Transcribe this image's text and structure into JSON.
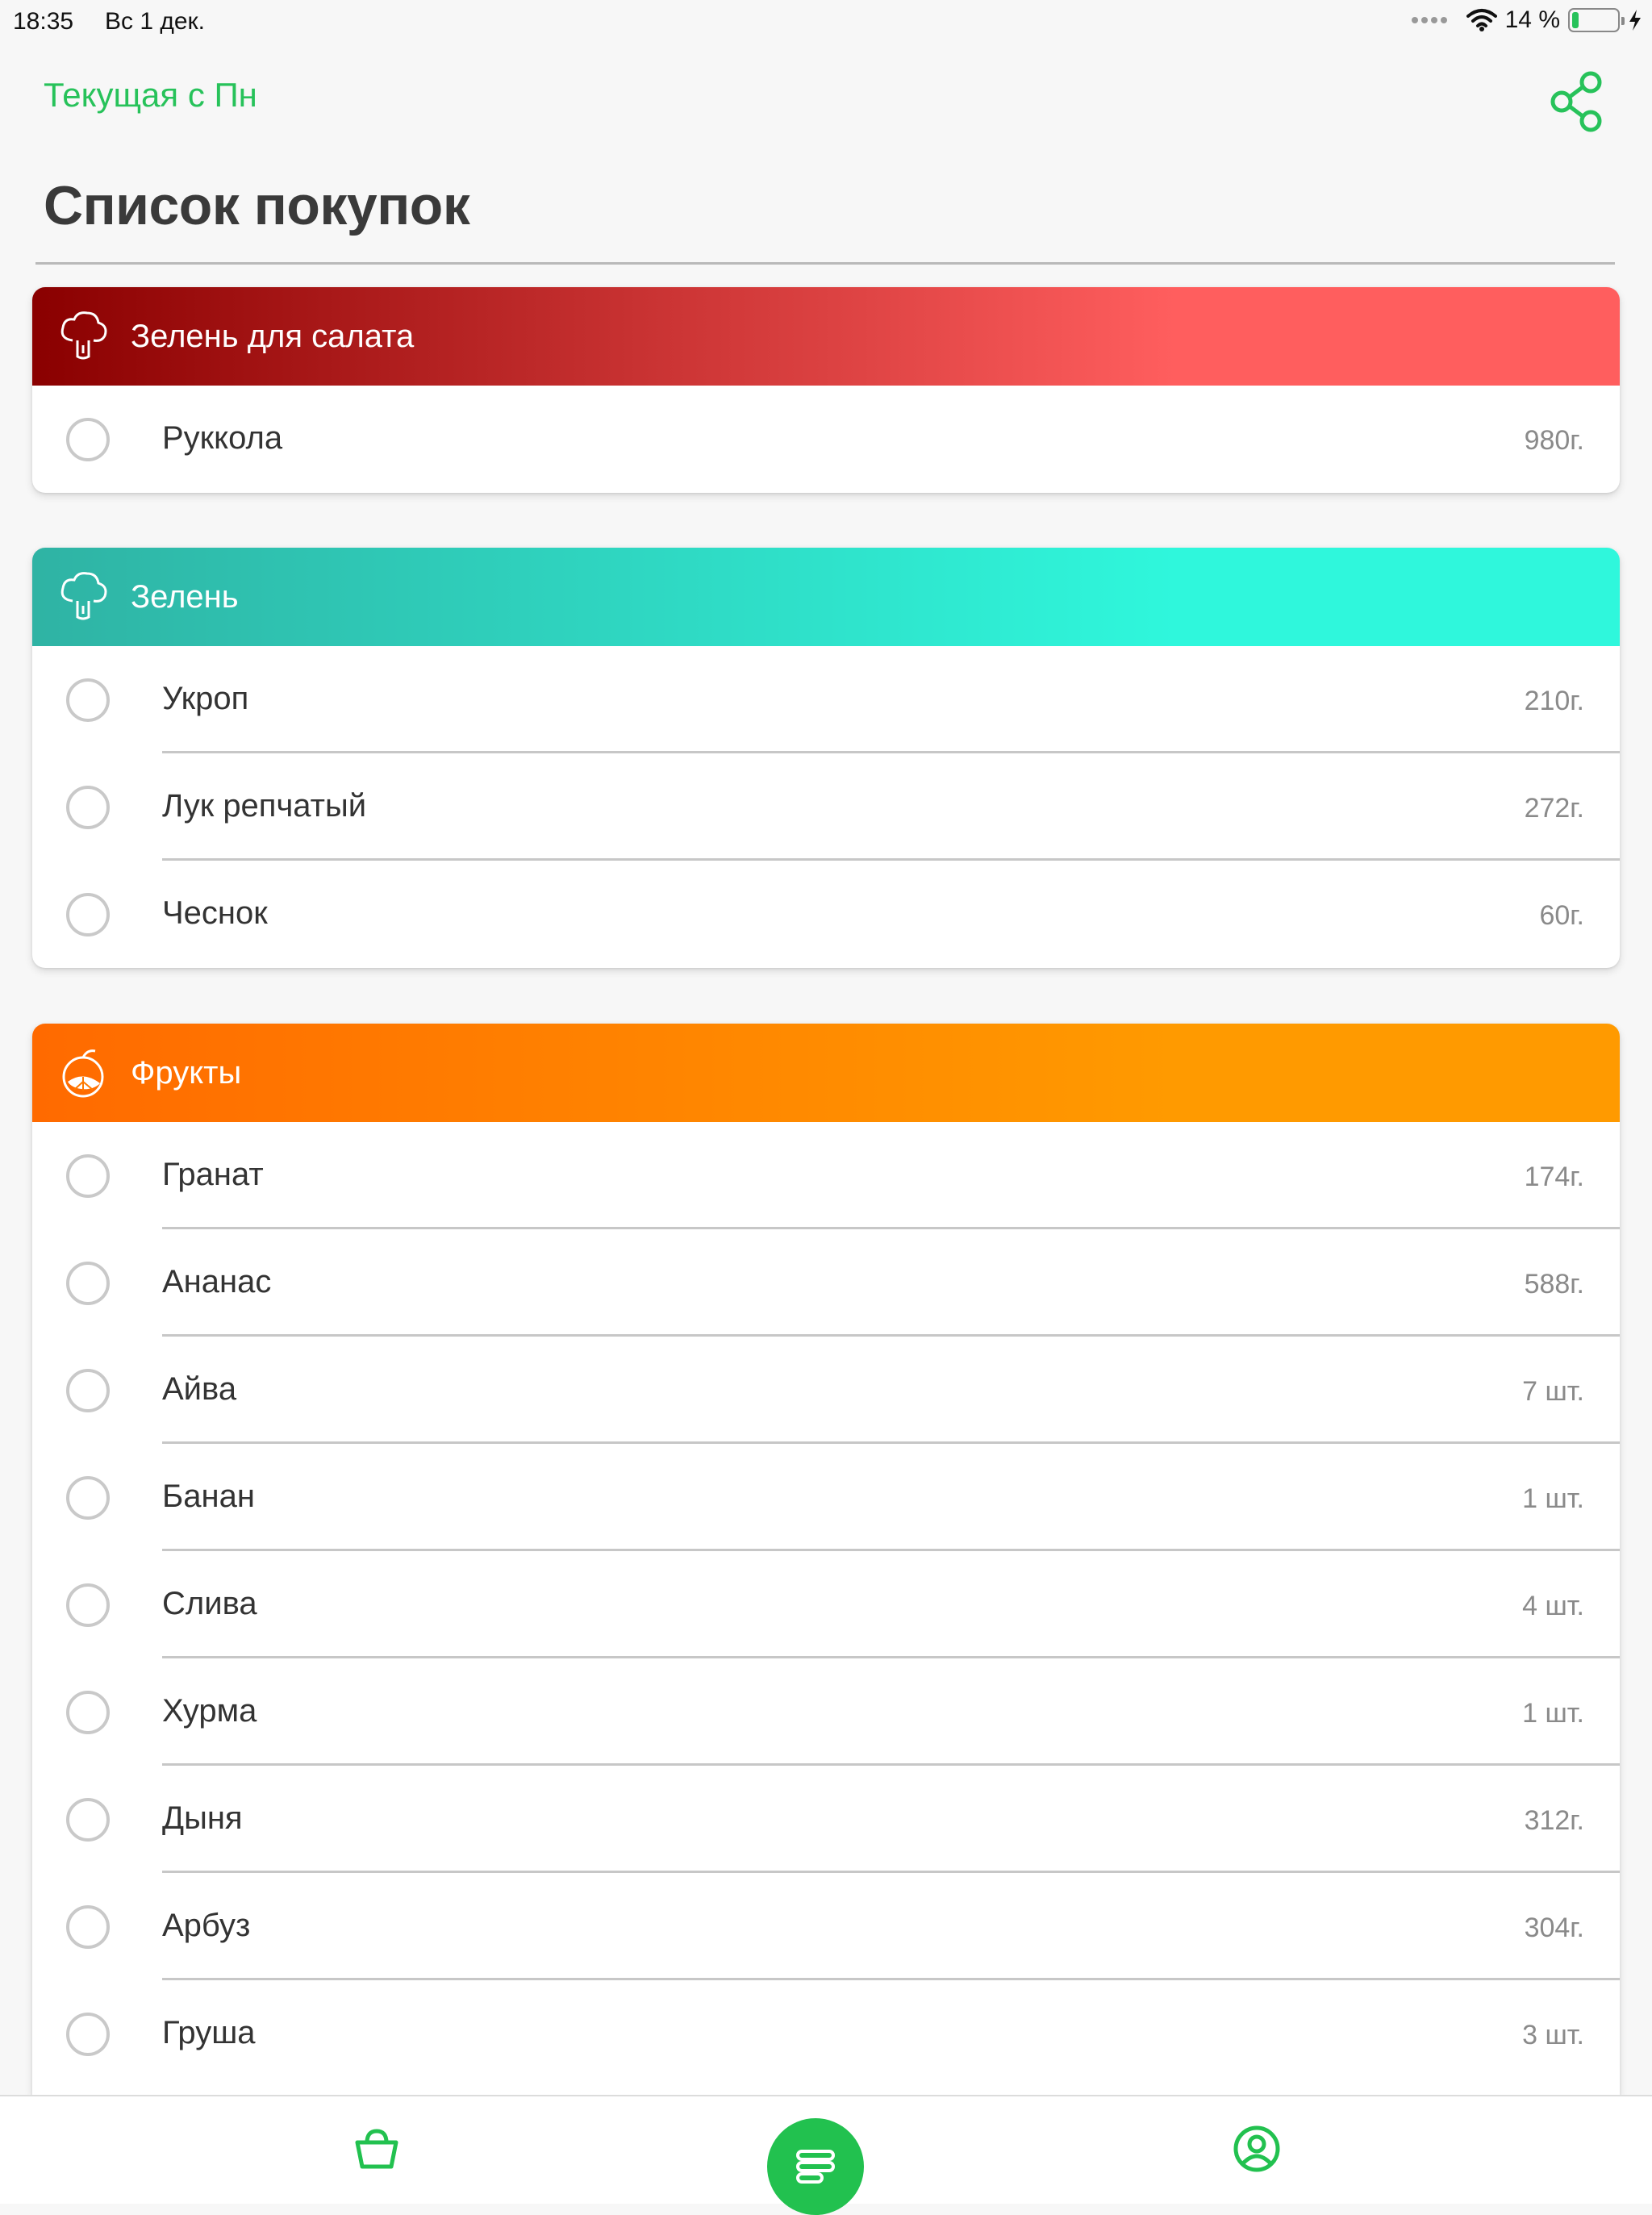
{
  "status_bar": {
    "time": "18:35",
    "date": "Вс 1 дек.",
    "battery": "14 %",
    "battery_level": 0.14,
    "icons": [
      "cellular-dots-icon",
      "wifi-icon",
      "battery-icon",
      "charging-bolt-icon"
    ]
  },
  "nav": {
    "back_label": "Текущая с Пн",
    "share_icon": "share-icon",
    "accent": "#27c25a"
  },
  "page_title": "Список покупок",
  "categories": [
    {
      "title": "Зелень для салата",
      "icon": "broccoli-icon",
      "gradient": [
        "#8a0000",
        "#ff5e5e"
      ],
      "items": [
        {
          "name": "Руккола",
          "qty": "980г."
        }
      ]
    },
    {
      "title": "Зелень",
      "icon": "broccoli-icon",
      "gradient": [
        "#2fb3a4",
        "#2ff7dc"
      ],
      "items": [
        {
          "name": "Укроп",
          "qty": "210г."
        },
        {
          "name": "Лук репчатый",
          "qty": "272г."
        },
        {
          "name": "Чеснок",
          "qty": "60г."
        }
      ]
    },
    {
      "title": "Фрукты",
      "icon": "citrus-fruit-icon",
      "gradient": [
        "#ff6a00",
        "#ff9a00"
      ],
      "items": [
        {
          "name": "Гранат",
          "qty": "174г."
        },
        {
          "name": "Ананас",
          "qty": "588г."
        },
        {
          "name": "Айва",
          "qty": "7 шт."
        },
        {
          "name": "Банан",
          "qty": "1 шт."
        },
        {
          "name": "Слива",
          "qty": "4 шт."
        },
        {
          "name": "Хурма",
          "qty": "1 шт."
        },
        {
          "name": "Дыня",
          "qty": "312г."
        },
        {
          "name": "Арбуз",
          "qty": "304г."
        },
        {
          "name": "Груша",
          "qty": "3 шт."
        }
      ]
    }
  ],
  "tab_bar": {
    "tabs": [
      {
        "icon": "basket-icon",
        "active": false
      },
      {
        "icon": "list-icon",
        "active": true
      },
      {
        "icon": "profile-icon",
        "active": false
      }
    ],
    "active_color": "#22c14f"
  }
}
